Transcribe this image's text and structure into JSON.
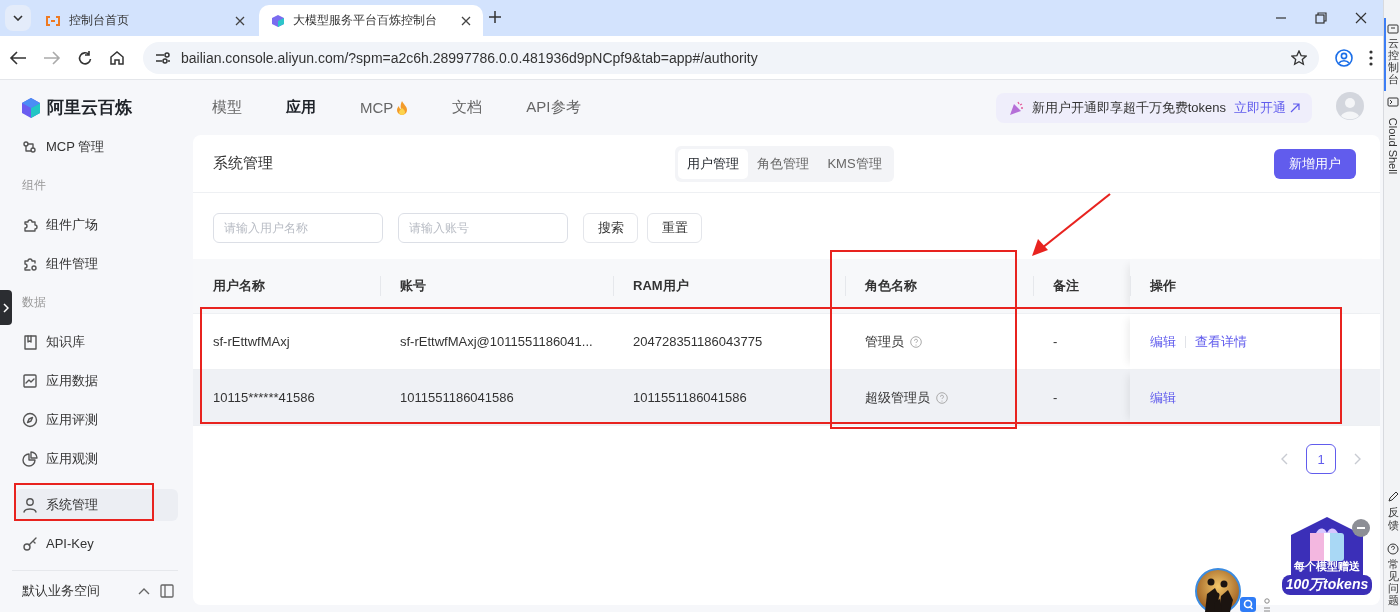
{
  "browser": {
    "tabs": [
      {
        "title": "控制台首页",
        "selected": false
      },
      {
        "title": "大模型服务平台百炼控制台",
        "selected": true
      }
    ],
    "url": "bailian.console.aliyun.com/?spm=a2c6h.28997786.0.0.481936d9pNCpf9&tab=app#/authority"
  },
  "header": {
    "logo": "阿里云百炼",
    "nav": [
      {
        "label": "模型",
        "selected": false
      },
      {
        "label": "应用",
        "selected": true
      },
      {
        "label": "MCP",
        "selected": false
      },
      {
        "label": "文档",
        "selected": false
      },
      {
        "label": "API参考",
        "selected": false
      }
    ],
    "promo": {
      "text": "新用户开通即享超千万免费tokens",
      "link": "立即开通"
    }
  },
  "sidebar": {
    "items": [
      {
        "kind": "item",
        "label": "MCP 管理",
        "selected": false
      },
      {
        "kind": "heading",
        "label": "组件"
      },
      {
        "kind": "item",
        "label": "组件广场",
        "selected": false
      },
      {
        "kind": "item",
        "label": "组件管理",
        "selected": false
      },
      {
        "kind": "heading",
        "label": "数据"
      },
      {
        "kind": "item",
        "label": "知识库",
        "selected": false
      },
      {
        "kind": "item",
        "label": "应用数据",
        "selected": false
      },
      {
        "kind": "item",
        "label": "应用评测",
        "selected": false
      },
      {
        "kind": "item",
        "label": "应用观测",
        "selected": false
      },
      {
        "kind": "item",
        "label": "系统管理",
        "selected": true
      },
      {
        "kind": "item",
        "label": "API-Key",
        "selected": false
      }
    ],
    "workspace": "默认业务空间"
  },
  "page": {
    "title": "系统管理",
    "tabs": [
      {
        "label": "用户管理",
        "selected": true
      },
      {
        "label": "角色管理",
        "selected": false
      },
      {
        "label": "KMS管理",
        "selected": false
      }
    ],
    "primary_button": "新增用户",
    "filters": [
      {
        "placeholder": "请输入用户名称"
      },
      {
        "placeholder": "请输入账号"
      }
    ],
    "buttons": [
      "搜索",
      "重置"
    ],
    "table": {
      "columns": [
        "用户名称",
        "账号",
        "RAM用户",
        "角色名称",
        "备注",
        "操作"
      ],
      "rows": [
        {
          "hovered": false,
          "cells": [
            "sf-rEttwfMAxj",
            "sf-rEttwfMAxj@1011551186041...",
            "204728351186043775"
          ],
          "role": "管理员",
          "note": "-",
          "actions": [
            "编辑",
            "查看详情"
          ]
        },
        {
          "hovered": true,
          "cells": [
            "10115******41586",
            "1011551186041586",
            "1011551186041586"
          ],
          "role": "超级管理员",
          "note": "-",
          "actions": [
            "编辑"
          ]
        }
      ]
    },
    "pagination": {
      "pages": [
        {
          "label": "1",
          "selected": true
        }
      ]
    }
  },
  "promo_badge": {
    "line_1": "每个模型赠送",
    "line_2": "100万tokens"
  },
  "right_rail": {
    "top_items": [
      {
        "label": "云控制台",
        "kind": "vertical",
        "selected": true
      },
      {
        "label": "Cloud Shell",
        "kind": "rotated",
        "selected": false
      }
    ],
    "bottom_items": [
      {
        "label": "反馈",
        "kind": "vertical",
        "selected": false
      },
      {
        "label": "常见问题",
        "kind": "vertical",
        "selected": false
      }
    ]
  }
}
